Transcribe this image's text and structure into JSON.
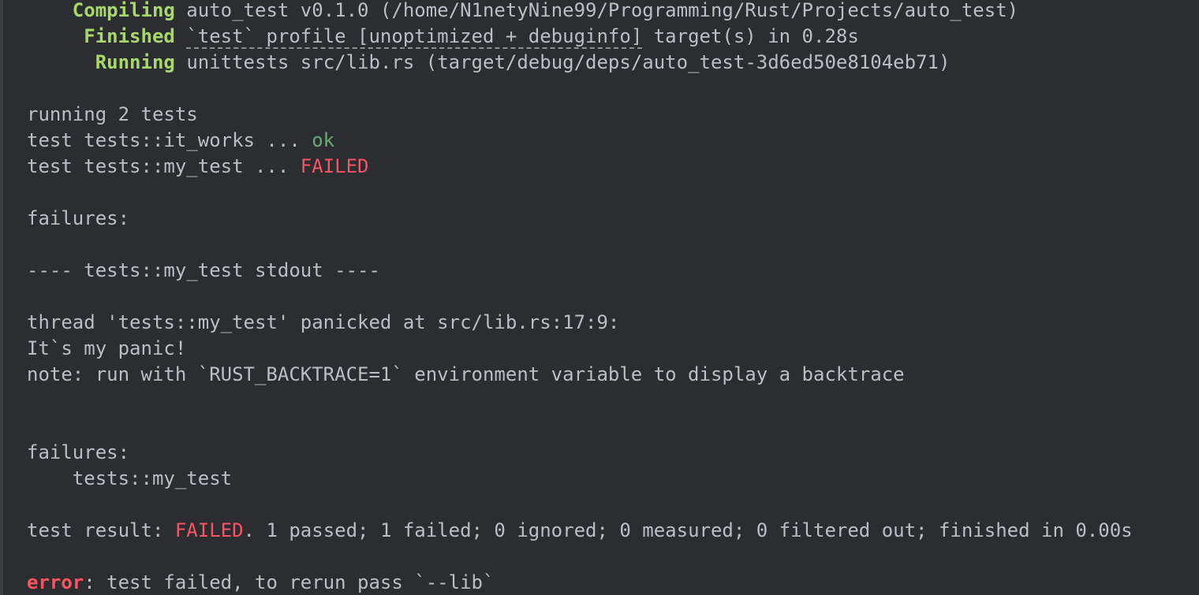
{
  "cargo": {
    "compiling": {
      "label": "Compiling",
      "text": "auto_test v0.1.0 (/home/N1netyNine99/Programming/Rust/Projects/auto_test)"
    },
    "finished": {
      "label": "Finished",
      "profile": "`test` profile [unoptimized + debuginfo]",
      "text": " target(s) in 0.28s"
    },
    "running": {
      "label": "Running",
      "text": "unittests src/lib.rs (target/debug/deps/auto_test-3d6ed50e8104eb71)"
    }
  },
  "run": {
    "header": "running 2 tests",
    "tests": [
      {
        "prefix": "test tests::it_works ... ",
        "status": "ok"
      },
      {
        "prefix": "test tests::my_test ... ",
        "status": "FAILED"
      }
    ]
  },
  "failures": {
    "header": "failures:",
    "stdout_header": "---- tests::my_test stdout ----",
    "panic": "thread 'tests::my_test' panicked at src/lib.rs:17:9:",
    "message": "It`s my panic!",
    "note": "note: run with `RUST_BACKTRACE=1` environment variable to display a backtrace",
    "list_header": "failures:",
    "list": [
      "    tests::my_test"
    ]
  },
  "result": {
    "prefix": "test result: ",
    "status": "FAILED",
    "summary": ". 1 passed; 1 failed; 0 ignored; 0 measured; 0 filtered out; finished in 0.00s"
  },
  "error": {
    "label": "error",
    "text": ": test failed, to rerun pass `--lib`"
  },
  "colors": {
    "background": "#2b2d30",
    "text": "#bcbec4",
    "ok": "#6aab73",
    "failed": "#f75464",
    "cargo_status": "#a8d86c"
  }
}
